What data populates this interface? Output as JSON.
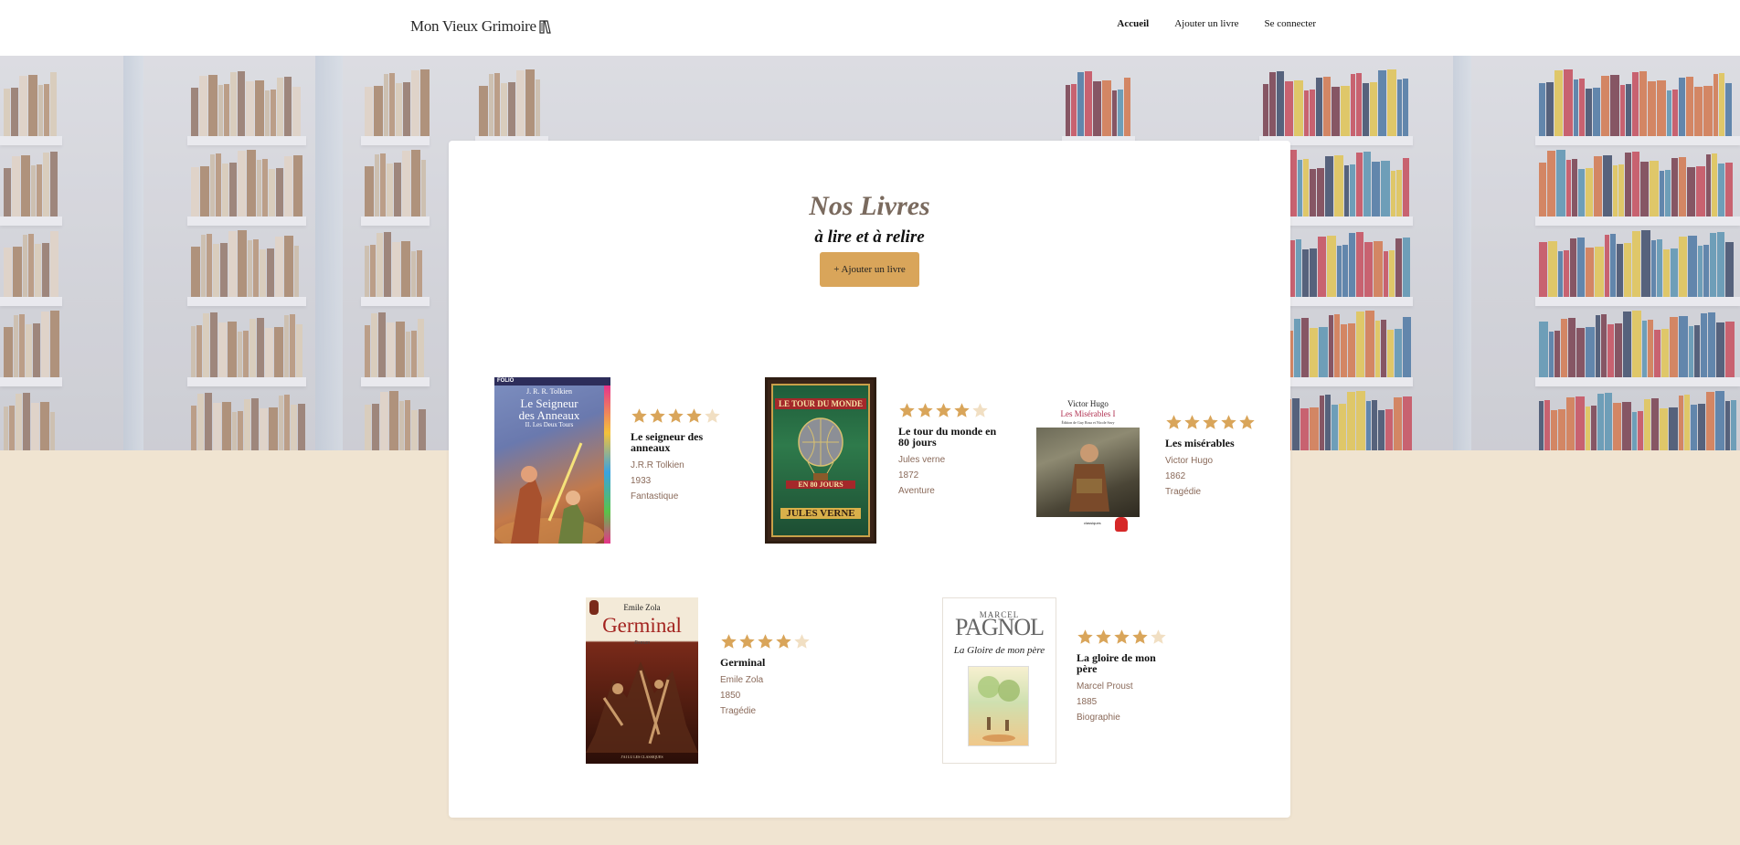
{
  "header": {
    "logo_text": "Mon Vieux Grimoire",
    "nav": [
      {
        "label": "Accueil",
        "active": true
      },
      {
        "label": "Ajouter un livre",
        "active": false
      },
      {
        "label": "Se connecter",
        "active": false
      }
    ]
  },
  "main": {
    "title": "Nos Livres",
    "subtitle": "à lire et à relire",
    "add_button_label": "+ Ajouter un livre"
  },
  "colors": {
    "accent": "#d9a55a",
    "star_filled": "#d9a55a",
    "star_empty": "#f1dfc3",
    "page_bg": "#f0e4d1"
  },
  "books": [
    {
      "title": "Le seigneur des anneaux",
      "author": "J.R.R Tolkien",
      "year": "1933",
      "genre": "Fantastique",
      "rating": 4,
      "cover_text": [
        "J. R. R. Tolkien",
        "Le Seigneur",
        "des Anneaux",
        "II. Les Deux Tours"
      ],
      "cover_label": "FOLIO"
    },
    {
      "title": "Le tour du monde en 80 jours",
      "author": "Jules verne",
      "year": "1872",
      "genre": "Aventure",
      "rating": 4,
      "cover_text": [
        "LE TOUR DU MONDE",
        "EN 80 JOURS",
        "JULES VERNE"
      ]
    },
    {
      "title": "Les misérables",
      "author": "Victor Hugo",
      "year": "1862",
      "genre": "Tragédie",
      "rating": 5,
      "cover_text": [
        "Victor Hugo",
        "Les Misérables I",
        "Édition de Guy Rosa et Nicole Savy",
        "classiques"
      ]
    },
    {
      "title": "Germinal",
      "author": "Emile Zola",
      "year": "1850",
      "genre": "Tragédie",
      "rating": 4,
      "cover_text": [
        "Emile Zola",
        "Germinal",
        "Roman",
        "J'AI LU LES CLASSIQUES"
      ]
    },
    {
      "title": "La gloire de mon père",
      "author": "Marcel Proust",
      "year": "1885",
      "genre": "Biographie",
      "rating": 4,
      "cover_text": [
        "MARCEL",
        "PAGNOL",
        "La Gloire de mon père"
      ]
    }
  ]
}
